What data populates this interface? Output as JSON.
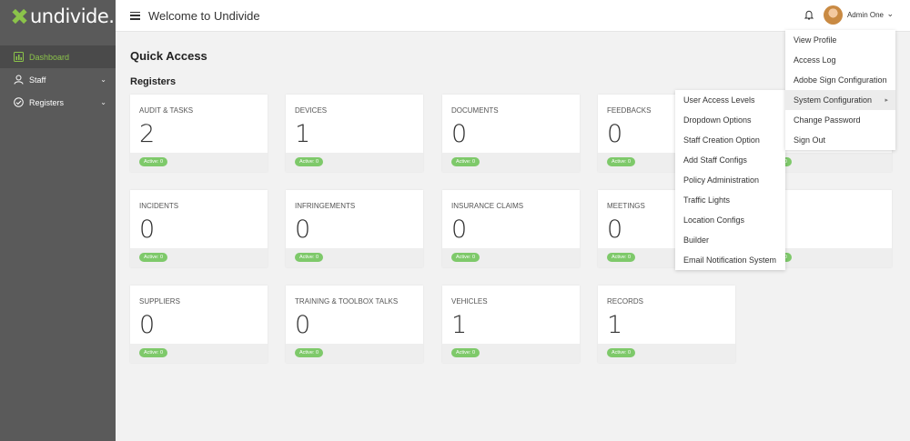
{
  "app": {
    "logo_text": "undivide.",
    "welcome": "Welcome to Undivide"
  },
  "sidebar": {
    "items": [
      {
        "label": "Dashboard",
        "icon": "dashboard-icon",
        "active": true
      },
      {
        "label": "Staff",
        "icon": "person-icon",
        "active": false
      },
      {
        "label": "Registers",
        "icon": "check-circle-icon",
        "active": false
      }
    ]
  },
  "header": {
    "user_name": "Admin One"
  },
  "main": {
    "page_title": "Quick Access",
    "section_title": "Registers"
  },
  "cards": [
    {
      "label": "AUDIT & TASKS",
      "count": "2",
      "badge": "Active: 0"
    },
    {
      "label": "DEVICES",
      "count": "1",
      "badge": "Active: 0"
    },
    {
      "label": "DOCUMENTS",
      "count": "0",
      "badge": "Active: 0"
    },
    {
      "label": "FEEDBACKS",
      "count": "0",
      "badge": "Active: 0"
    },
    {
      "label": "",
      "count": "",
      "badge": "Active: 0"
    },
    {
      "label": "INCIDENTS",
      "count": "0",
      "badge": "Active: 0"
    },
    {
      "label": "INFRINGEMENTS",
      "count": "0",
      "badge": "Active: 0"
    },
    {
      "label": "INSURANCE CLAIMS",
      "count": "0",
      "badge": "Active: 0"
    },
    {
      "label": "MEETINGS",
      "count": "0",
      "badge": "Active: 0"
    },
    {
      "label": "",
      "count": "",
      "badge": "Active: 0"
    },
    {
      "label": "SUPPLIERS",
      "count": "0",
      "badge": "Active: 0"
    },
    {
      "label": "TRAINING & TOOLBOX TALKS",
      "count": "0",
      "badge": "Active: 0"
    },
    {
      "label": "VEHICLES",
      "count": "1",
      "badge": "Active: 0"
    },
    {
      "label": "RECORDS",
      "count": "1",
      "badge": "Active: 0"
    }
  ],
  "user_menu": {
    "items": [
      "View Profile",
      "Access Log",
      "Adobe Sign Configuration",
      "System Configuration",
      "Change Password",
      "Sign Out"
    ]
  },
  "system_menu": {
    "items": [
      "User Access Levels",
      "Dropdown Options",
      "Staff Creation Option",
      "Add Staff Configs",
      "Policy Administration",
      "Traffic Lights",
      "Location Configs",
      "Builder",
      "Email Notification System"
    ]
  },
  "colors": {
    "accent": "#8bc34a",
    "sidebar": "#5a5a5a",
    "badge": "#7ec96a"
  }
}
